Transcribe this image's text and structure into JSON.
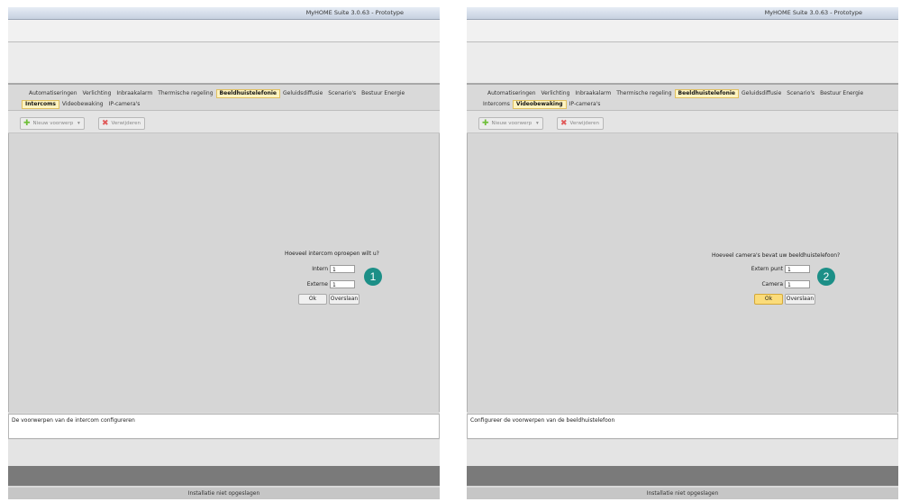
{
  "panels": [
    {
      "window_title": "MyHOME Suite 3.0.63 - Prototype",
      "main_tabs": [
        "Automatiseringen",
        "Verlichting",
        "Inbraakalarm",
        "Thermische regeling",
        "Beeldhuistelefonie",
        "Geluidsdiffusie",
        "Scenario's",
        "Bestuur Energie"
      ],
      "main_tab_active": "Beeldhuistelefonie",
      "sub_tabs": [
        "Intercoms",
        "Videobewaking",
        "IP-camera's"
      ],
      "sub_tab_active": "Intercoms",
      "toolbar": {
        "new_label": "Nieuw voorwerp",
        "delete_label": "Verwijderen"
      },
      "dialog": {
        "question": "Hoeveel intercom oproepen wilt u?",
        "field1_label": "Intern",
        "field1_value": "1",
        "field2_label": "Externe",
        "field2_value": "1",
        "ok_label": "Ok",
        "skip_label": "Overslaan"
      },
      "badge": "1",
      "status_text": "De voorwerpen van de intercom configureren",
      "footer_status": "Installatie niet opgeslagen"
    },
    {
      "window_title": "MyHOME Suite 3.0.63 - Prototype",
      "main_tabs": [
        "Automatiseringen",
        "Verlichting",
        "Inbraakalarm",
        "Thermische regeling",
        "Beeldhuistelefonie",
        "Geluidsdiffusie",
        "Scenario's",
        "Bestuur Energie"
      ],
      "main_tab_active": "Beeldhuistelefonie",
      "sub_tabs": [
        "Intercoms",
        "Videobewaking",
        "IP-camera's"
      ],
      "sub_tab_active": "Videobewaking",
      "toolbar": {
        "new_label": "Nieuw voorwerp",
        "delete_label": "Verwijderen"
      },
      "dialog": {
        "question": "Hoeveel camera's bevat uw beeldhuistelefoon?",
        "field1_label": "Extern punt",
        "field1_value": "1",
        "field2_label": "Camera",
        "field2_value": "1",
        "ok_label": "Ok",
        "skip_label": "Overslaan"
      },
      "badge": "2",
      "status_text": "Configureer de voorwerpen van de beeldhuistelefoon",
      "footer_status": "Installatie niet opgeslagen"
    }
  ],
  "colors": {
    "badge": "#1c8f87",
    "active_tab": "#fdf3c0",
    "ok_highlight": "#fbdc7a"
  },
  "icons": {
    "new": "plus-icon",
    "delete": "cross-icon",
    "dropdown": "chevron-down-icon"
  }
}
